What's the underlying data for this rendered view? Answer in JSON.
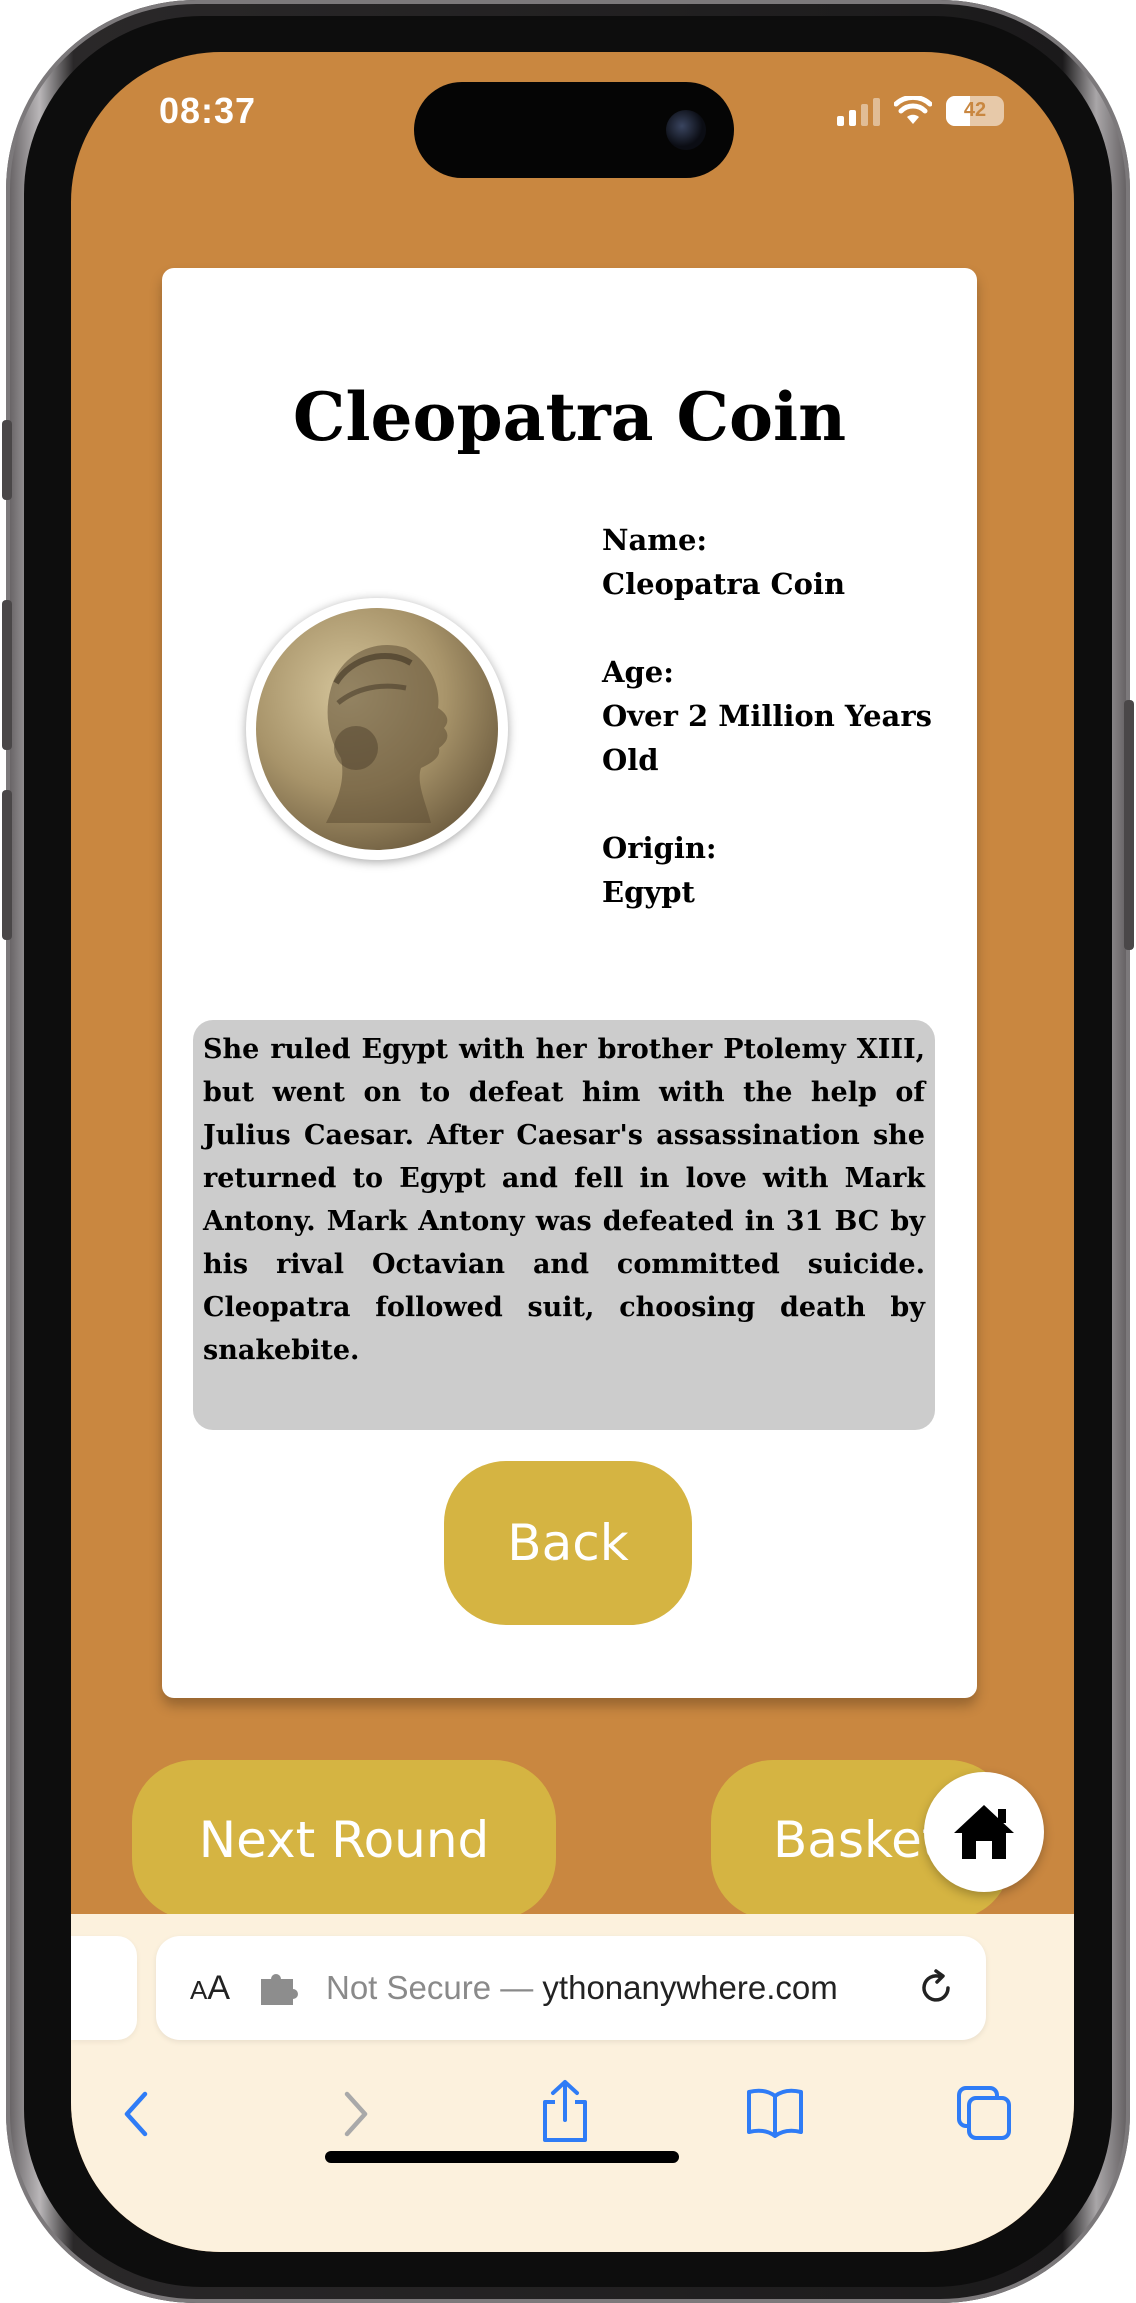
{
  "status_bar": {
    "time": "08:37",
    "battery": "42"
  },
  "card": {
    "title": "Cleopatra Coin",
    "name_label": "Name:",
    "name_value": "Cleopatra Coin",
    "age_label": "Age:",
    "age_value": "Over 2 Million Years Old",
    "origin_label": "Origin:",
    "origin_value": "Egypt",
    "description": "She ruled Egypt with her brother Ptolemy XIII, but went on to defeat him with the help of Julius Caesar. After Caesar's assassination she returned to Egypt and fell in love with Mark Antony. Mark Antony was defeated in 31 BC by his rival Octavian and committed suicide. Cleopatra followed suit, choosing death by snakebite.",
    "back_label": "Back"
  },
  "actions": {
    "next_round_label": "Next Round",
    "basket_label": "Basket"
  },
  "browser": {
    "aa_label": "AA",
    "url_prefix": "Not Secure — ",
    "url_domain": "ythonanywhere.com"
  },
  "icons": [
    "wifi-icon",
    "signal-icon",
    "battery-icon",
    "home-icon",
    "extension-icon",
    "reload-icon",
    "back-icon",
    "forward-icon",
    "share-icon",
    "bookmarks-icon",
    "tabs-icon"
  ],
  "colors": {
    "background": "#c98740",
    "button": "#d5b442",
    "card": "#ffffff",
    "description_bg": "#cccccc",
    "safari_bar": "#fcf1dd",
    "ios_blue": "#2f7cf6"
  }
}
